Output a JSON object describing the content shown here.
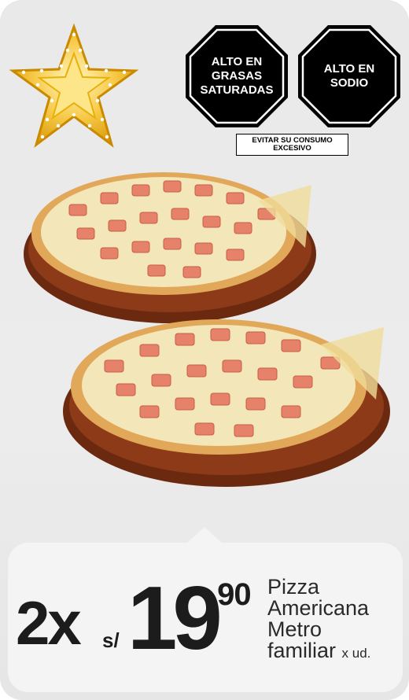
{
  "warnings": {
    "octagon_1": "ALTO EN\nGRASAS\nSATURADAS",
    "octagon_2": "ALTO EN\nSODIO",
    "advisory": "EVITAR SU CONSUMO\nEXCESIVO"
  },
  "offer": {
    "quantity": "2x",
    "currency": "s/",
    "price_integer": "19",
    "price_decimal": ".90",
    "product_line_1": "Pizza",
    "product_line_2": "Americana",
    "product_line_3": "Metro",
    "product_line_4": "familiar",
    "unit": "x ud."
  },
  "icons": {
    "star": "star-icon",
    "pizza": "pizza-image"
  },
  "colors": {
    "card_background": "#e9e9e9",
    "warning_black": "#000000",
    "price_text": "#1c1c1c",
    "star_gold": "#f2b705"
  }
}
